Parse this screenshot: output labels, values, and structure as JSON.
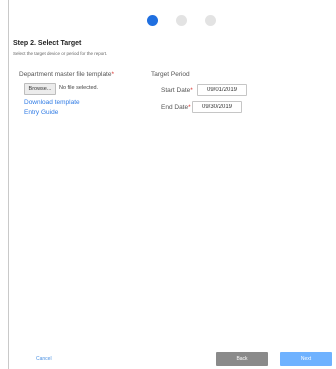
{
  "step": {
    "title": "Step 2. Select Target",
    "subtitle": "Select the target device or period for the report."
  },
  "template": {
    "label": "Department master file template",
    "required_mark": "*",
    "browse_label": "Browse...",
    "file_status": "No file selected.",
    "download_link": "Download template",
    "guide_link": "Entry Guide"
  },
  "period": {
    "label": "Target Period",
    "start_label": "Start Date",
    "start_value": "09/01/2019",
    "end_label": "End Date",
    "end_value": "09/30/2019",
    "required_mark": "*"
  },
  "footer": {
    "cancel": "Cancel",
    "back": "Back",
    "next": "Next"
  },
  "colors": {
    "active_step": "#1f6fe0",
    "inactive_step": "#e3e3e3",
    "link": "#2f7be5",
    "required": "#d9302c",
    "back_button": "#8a8a8a",
    "next_button": "#6fb2ff"
  }
}
